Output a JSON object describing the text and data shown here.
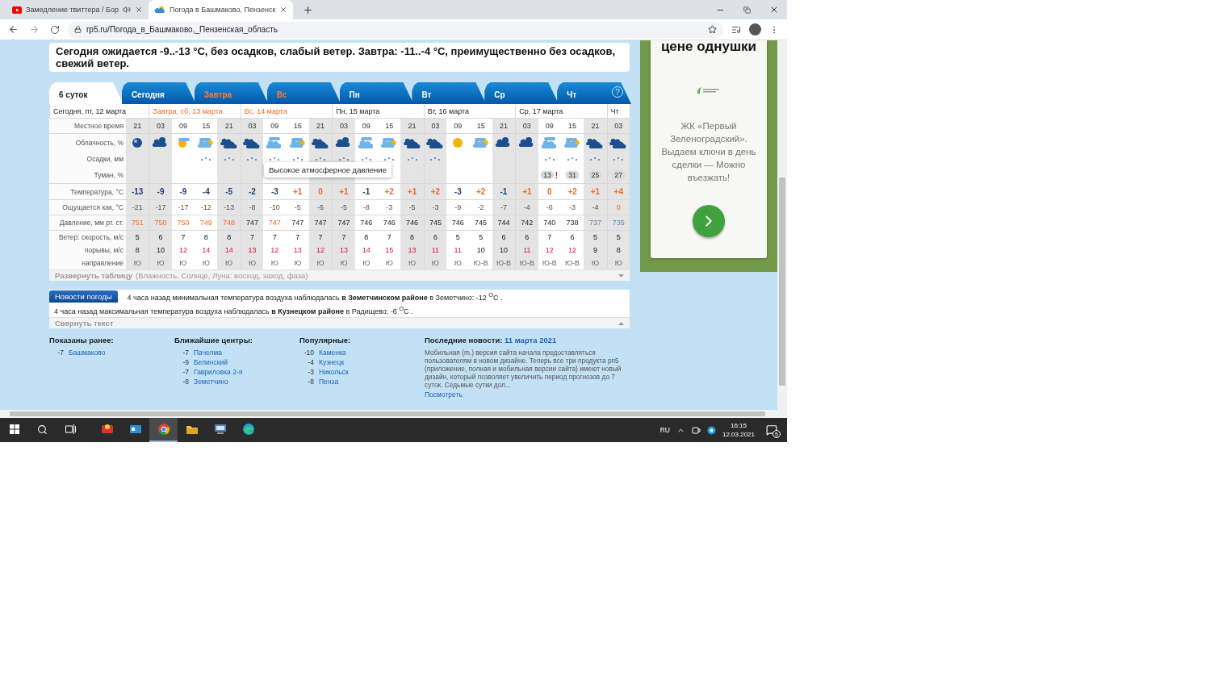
{
  "browser": {
    "tabs": [
      {
        "title": "Замедление твиттера / Бор",
        "kind": "video",
        "audio": true,
        "selected": false
      },
      {
        "title": "Погода в Башмаково, Пензенск",
        "kind": "weather",
        "audio": false,
        "selected": true
      }
    ],
    "address": "rp5.ru/Погода_в_Башмаково,_Пензенская_область"
  },
  "forecast": {
    "summary": "Сегодня ожидается -9..-13 °C, без осадков, слабый ветер. Завтра: -11..-4 °C, преимущественно без осадков, свежий ветер.",
    "tabs": [
      {
        "label": "6 суток",
        "selected": true,
        "weekend": false
      },
      {
        "label": "Сегодня",
        "selected": false,
        "weekend": false
      },
      {
        "label": "Завтра",
        "selected": false,
        "weekend": true
      },
      {
        "label": "Вс",
        "selected": false,
        "weekend": true
      },
      {
        "label": "Пн",
        "selected": false,
        "weekend": false
      },
      {
        "label": "Вт",
        "selected": false,
        "weekend": false
      },
      {
        "label": "Ср",
        "selected": false,
        "weekend": false
      },
      {
        "label": "Чт",
        "selected": false,
        "weekend": false
      }
    ],
    "help": "?",
    "row_labels": [
      "Местное время",
      "Облачность, %",
      "Осадки, мм",
      "Туман, %",
      "Температура, °C",
      "Ощущается как, °C",
      "Давление, мм рт. ст.",
      "Ветер: скорость, м/с",
      "порывы, м/с",
      "направление"
    ],
    "days": [
      {
        "label": "Сегодня, пт, 12 марта",
        "weekend": false,
        "columns": [
          {
            "time": "21",
            "night": true,
            "kind": "night-clear",
            "precip": false,
            "temp": "-13",
            "warm": false,
            "feels": "-21",
            "feels_warm": false,
            "pressure": {
              "value": "751",
              "kind": "high"
            },
            "wind": "5",
            "gust": "8",
            "gust_strong": false,
            "dir": "Ю"
          }
        ]
      },
      {
        "label": "Завтра, сб, 13 марта",
        "weekend": true,
        "columns": [
          {
            "time": "03",
            "night": true,
            "kind": "night-partly",
            "precip": false,
            "temp": "-9",
            "warm": false,
            "feels": "-17",
            "feels_warm": false,
            "pressure": {
              "value": "750",
              "kind": "high"
            },
            "wind": "6",
            "gust": "10",
            "gust_strong": false,
            "dir": "Ю"
          },
          {
            "time": "09",
            "night": false,
            "kind": "clear-partly",
            "precip": false,
            "temp": "-9",
            "warm": false,
            "feels": "-17",
            "feels_warm": false,
            "pressure": {
              "value": "750",
              "kind": "high"
            },
            "wind": "7",
            "gust": "12",
            "gust_strong": true,
            "dir": "Ю"
          },
          {
            "time": "15",
            "night": false,
            "kind": "partly",
            "precip": true,
            "temp": "-4",
            "warm": false,
            "feels": "-12",
            "feels_warm": false,
            "pressure": {
              "value": "749",
              "kind": "high"
            },
            "wind": "8",
            "gust": "14",
            "gust_strong": true,
            "dir": "Ю"
          },
          {
            "time": "21",
            "night": true,
            "kind": "overcast",
            "precip": true,
            "temp": "-5",
            "warm": false,
            "feels": "-13",
            "feels_warm": false,
            "pressure": {
              "value": "748",
              "kind": "high"
            },
            "wind": "8",
            "gust": "14",
            "gust_strong": true,
            "dir": "Ю"
          }
        ]
      },
      {
        "label": "Вс, 14 марта",
        "weekend": true,
        "columns": [
          {
            "time": "03",
            "night": true,
            "kind": "overcast",
            "precip": true,
            "temp": "-2",
            "warm": false,
            "feels": "-8",
            "feels_warm": false,
            "pressure": {
              "value": "747",
              "kind": "normal"
            },
            "wind": "7",
            "gust": "13",
            "gust_strong": true,
            "dir": "Ю"
          },
          {
            "time": "09",
            "night": false,
            "kind": "cloudy",
            "precip": true,
            "temp": "-3",
            "warm": false,
            "feels": "-10",
            "feels_warm": false,
            "pressure": {
              "value": "747",
              "kind": "high"
            },
            "wind": "7",
            "gust": "12",
            "gust_strong": true,
            "dir": "Ю"
          },
          {
            "time": "15",
            "night": false,
            "kind": "partly",
            "precip": true,
            "temp": "+1",
            "warm": true,
            "feels": "-5",
            "feels_warm": false,
            "pressure": {
              "value": "747",
              "kind": "normal"
            },
            "wind": "7",
            "gust": "13",
            "gust_strong": true,
            "dir": "Ю"
          },
          {
            "time": "21",
            "night": true,
            "kind": "overcast",
            "precip": true,
            "temp": "0",
            "warm": true,
            "feels": "-6",
            "feels_warm": false,
            "pressure": {
              "value": "747",
              "kind": "normal"
            },
            "wind": "7",
            "gust": "12",
            "gust_strong": true,
            "dir": "Ю"
          }
        ]
      },
      {
        "label": "Пн, 15 марта",
        "weekend": false,
        "columns": [
          {
            "time": "03",
            "night": true,
            "kind": "night-partly",
            "precip": true,
            "temp": "+1",
            "warm": true,
            "feels": "-5",
            "feels_warm": false,
            "pressure": {
              "value": "747",
              "kind": "normal"
            },
            "wind": "7",
            "gust": "13",
            "gust_strong": true,
            "dir": "Ю"
          },
          {
            "time": "09",
            "night": false,
            "kind": "cloudy",
            "precip": true,
            "temp": "-1",
            "warm": false,
            "feels": "-8",
            "feels_warm": false,
            "pressure": {
              "value": "746",
              "kind": "normal"
            },
            "wind": "8",
            "gust": "14",
            "gust_strong": true,
            "dir": "Ю"
          },
          {
            "time": "15",
            "night": false,
            "kind": "partly",
            "precip": true,
            "temp": "+2",
            "warm": true,
            "feels": "-3",
            "feels_warm": false,
            "pressure": {
              "value": "746",
              "kind": "normal"
            },
            "wind": "7",
            "gust": "15",
            "gust_strong": true,
            "dir": "Ю"
          },
          {
            "time": "21",
            "night": true,
            "kind": "overcast",
            "precip": true,
            "temp": "+1",
            "warm": true,
            "feels": "-5",
            "feels_warm": false,
            "pressure": {
              "value": "746",
              "kind": "normal"
            },
            "wind": "8",
            "gust": "13",
            "gust_strong": true,
            "dir": "Ю"
          }
        ]
      },
      {
        "label": "Вт, 16 марта",
        "weekend": false,
        "columns": [
          {
            "time": "03",
            "night": true,
            "kind": "overcast",
            "precip": true,
            "temp": "+2",
            "warm": true,
            "feels": "-3",
            "feels_warm": false,
            "pressure": {
              "value": "745",
              "kind": "normal"
            },
            "wind": "6",
            "gust": "11",
            "gust_strong": true,
            "dir": "Ю"
          },
          {
            "time": "09",
            "night": false,
            "kind": "clear",
            "precip": false,
            "temp": "-3",
            "warm": false,
            "feels": "-9",
            "feels_warm": false,
            "pressure": {
              "value": "746",
              "kind": "normal"
            },
            "wind": "5",
            "gust": "11",
            "gust_strong": true,
            "dir": "Ю"
          },
          {
            "time": "15",
            "night": false,
            "kind": "partly",
            "precip": false,
            "temp": "+2",
            "warm": true,
            "feels": "-2",
            "feels_warm": false,
            "pressure": {
              "value": "745",
              "kind": "normal"
            },
            "wind": "5",
            "gust": "10",
            "gust_strong": false,
            "dir": "Ю-В"
          },
          {
            "time": "21",
            "night": true,
            "kind": "night-partly",
            "precip": false,
            "temp": "-1",
            "warm": false,
            "feels": "-7",
            "feels_warm": false,
            "pressure": {
              "value": "744",
              "kind": "normal"
            },
            "wind": "6",
            "gust": "10",
            "gust_strong": false,
            "dir": "Ю-В"
          }
        ]
      },
      {
        "label": "Ср, 17 марта",
        "weekend": false,
        "columns": [
          {
            "time": "03",
            "night": true,
            "kind": "night-partly",
            "precip": false,
            "temp": "+1",
            "warm": true,
            "feels": "-4",
            "feels_warm": false,
            "pressure": {
              "value": "742",
              "kind": "normal"
            },
            "wind": "6",
            "gust": "11",
            "gust_strong": true,
            "dir": "Ю-В"
          },
          {
            "time": "09",
            "night": false,
            "kind": "cloudy",
            "precip": true,
            "fog": {
              "value": "13",
              "alert": "!"
            },
            "temp": "0",
            "warm": true,
            "feels": "-6",
            "feels_warm": false,
            "pressure": {
              "value": "740",
              "kind": "normal"
            },
            "wind": "7",
            "gust": "12",
            "gust_strong": true,
            "dir": "Ю-В"
          },
          {
            "time": "15",
            "night": false,
            "kind": "partly",
            "precip": true,
            "fog": {
              "value": "31"
            },
            "temp": "+2",
            "warm": true,
            "feels": "-3",
            "feels_warm": false,
            "pressure": {
              "value": "738",
              "kind": "normal"
            },
            "wind": "6",
            "gust": "12",
            "gust_strong": true,
            "dir": "Ю-В"
          },
          {
            "time": "21",
            "night": true,
            "kind": "overcast",
            "precip": true,
            "fog": {
              "value": "25"
            },
            "temp": "+1",
            "warm": true,
            "feels": "-4",
            "feels_warm": false,
            "pressure": {
              "value": "737",
              "kind": "low"
            },
            "wind": "5",
            "gust": "9",
            "gust_strong": false,
            "dir": "Ю"
          }
        ]
      },
      {
        "label": "Чт",
        "weekend": false,
        "columns": [
          {
            "time": "03",
            "night": true,
            "kind": "overcast",
            "precip": true,
            "fog": {
              "value": "27"
            },
            "temp": "+4",
            "warm": true,
            "feels": "0",
            "feels_warm": true,
            "pressure": {
              "value": "735",
              "kind": "low"
            },
            "wind": "5",
            "gust": "8",
            "gust_strong": false,
            "dir": "Ю"
          }
        ]
      }
    ],
    "tooltip": "Высокое атмосферное давление",
    "expand": {
      "label": "Развернуть таблицу",
      "hint": "(Влажность. Солнце, Луна: восход, заход, фаза)"
    }
  },
  "news": {
    "badge": "Новости погоды",
    "items": [
      "4 часа назад минимальная температура воздуха наблюдалась **в Земетчинском районе** в Земетчино: -12 $^{O}$C .",
      "4 часа назад максимальная температура воздуха наблюдалась **в Кузнецком районе** в Радищево: -6 $^{O}$C ."
    ],
    "collapse": "Свернуть текст"
  },
  "footer": {
    "lists": [
      {
        "title": "Показаны ранее:",
        "links": [
          {
            "value": "-7",
            "name": "Башмаково"
          }
        ]
      },
      {
        "title": "Ближайшие центры:",
        "links": [
          {
            "value": "-7",
            "name": "Пачелма"
          },
          {
            "value": "-9",
            "name": "Белинский"
          },
          {
            "value": "-7",
            "name": "Гавриловка 2-я"
          },
          {
            "value": "-8",
            "name": "Земетчино"
          }
        ]
      },
      {
        "title": "Популярные:",
        "links": [
          {
            "value": "-10",
            "name": "Каменка"
          },
          {
            "value": "-4",
            "name": "Кузнецк"
          },
          {
            "value": "-3",
            "name": "Никольск"
          },
          {
            "value": "-8",
            "name": "Пенза"
          }
        ]
      }
    ],
    "latest": {
      "title": "Последние новости:",
      "date": "11 марта 2021",
      "text": "Мобильная (m.) версия сайта начала предоставляться пользователям в новом дизайне. Теперь все три продукта рп5 (приложение, полная и мобильная версии сайта) имеют новый дизайн, который позволяет увеличить период прогнозов до 7 суток. Седьмые сутки дол...",
      "link": "Посмотреть"
    }
  },
  "ad": {
    "headline": "цене однушки",
    "text": "ЖК «Первый Зеленоградский». Выдаем ключи в день сделки — Можно въезжать!"
  },
  "taskbar": {
    "apps": [
      {
        "kind": "game",
        "active": false
      },
      {
        "kind": "card",
        "active": false
      },
      {
        "kind": "chrome",
        "active": true
      },
      {
        "kind": "folder",
        "active": false
      },
      {
        "kind": "monitor",
        "active": false
      },
      {
        "kind": "edge",
        "active": false
      }
    ],
    "language": "RU",
    "time": "16:15",
    "date": "12.03.2021",
    "notifications": "5"
  }
}
